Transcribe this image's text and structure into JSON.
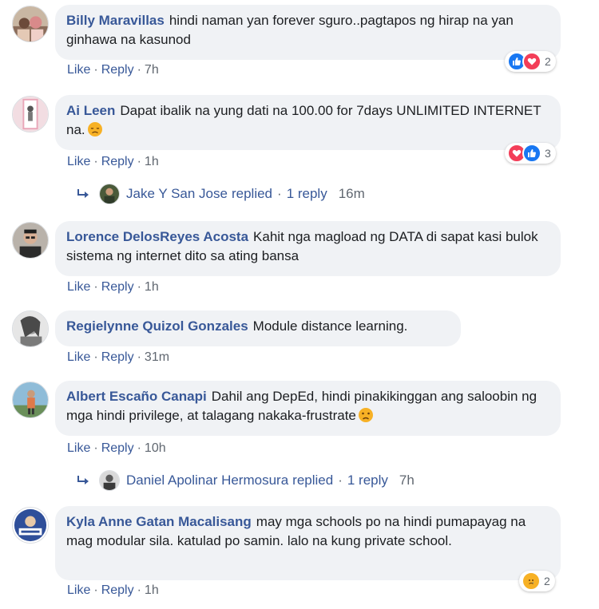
{
  "comments": [
    {
      "author": "Billy Maravillas",
      "text": "hindi naman yan forever sguro..pagtapos ng hirap na yan ginhawa na kasunod",
      "like": "Like",
      "reply": "Reply",
      "time": "7h",
      "reactions": {
        "icons": [
          "like",
          "love"
        ],
        "count": "2"
      }
    },
    {
      "author": "Ai Leen",
      "text": "Dapat ibalik na yung dati na 100.00 for 7days UNLIMITED INTERNET na.",
      "emoji": "sad-face-emoji",
      "like": "Like",
      "reply": "Reply",
      "time": "1h",
      "reactions": {
        "icons": [
          "love",
          "like"
        ],
        "count": "3"
      },
      "replied": {
        "name": "Jake Y San Jose",
        "label": "replied",
        "count": "1 reply",
        "time": "16m"
      }
    },
    {
      "author": "Lorence DelosReyes Acosta",
      "text": "Kahit nga magload ng DATA di sapat kasi bulok sistema ng internet dito sa ating bansa",
      "like": "Like",
      "reply": "Reply",
      "time": "1h"
    },
    {
      "author": "Regielynne Quizol Gonzales",
      "text": "Module distance learning.",
      "like": "Like",
      "reply": "Reply",
      "time": "31m"
    },
    {
      "author": "Albert Escaño Canapi",
      "text": "Dahil ang DepEd, hindi pinakikinggan ang saloobin ng mga hindi privilege, at talagang nakaka-frustrate",
      "emoji": "frown-face-emoji",
      "like": "Like",
      "reply": "Reply",
      "time": "10h",
      "replied": {
        "name": "Daniel Apolinar Hermosura",
        "label": "replied",
        "count": "1 reply",
        "time": "7h"
      }
    },
    {
      "author": "Kyla Anne Gatan Macalisang",
      "text": "may mga schools po na hindi pumapayag na mag modular sila. katulad po samin. lalo na kung private school.",
      "like": "Like",
      "reply": "Reply",
      "time": "1h",
      "reactions": {
        "icons": [
          "sad"
        ],
        "count": "2"
      }
    }
  ],
  "colors": {
    "link": "#385898",
    "bubble": "#f0f2f5",
    "meta": "#606770",
    "like_blue": "#1877f2",
    "love_red": "#f33e58",
    "sad_yellow": "#f7b125"
  }
}
